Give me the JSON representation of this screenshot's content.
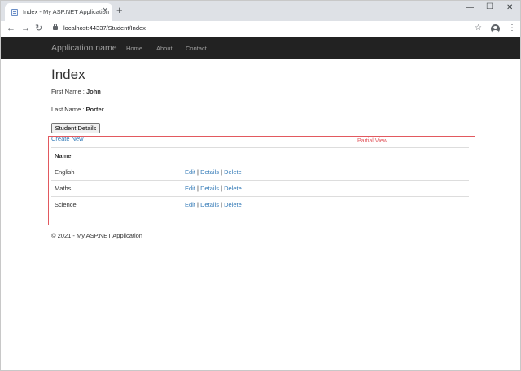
{
  "browser": {
    "tab_title": "Index - My ASP.NET Application",
    "new_tab_glyph": "+",
    "url": "localhost:44337/Student/Index"
  },
  "navbar": {
    "brand": "Application name",
    "links": [
      "Home",
      "About",
      "Contact"
    ]
  },
  "page": {
    "title": "Index",
    "first_name_label": "First Name :",
    "first_name_value": "John",
    "last_name_label": "Last Name :",
    "last_name_value": "Porter",
    "button_label": "Student Details"
  },
  "partial": {
    "annotation": "Partial View",
    "create_link": "Create New",
    "column_header": "Name",
    "rows": [
      {
        "name": "English"
      },
      {
        "name": "Maths"
      },
      {
        "name": "Science"
      }
    ],
    "action_labels": {
      "edit": "Edit",
      "details": "Details",
      "delete": "Delete",
      "separator": " | "
    }
  },
  "footer": "© 2021 - My ASP.NET Application",
  "colors": {
    "navbar": "#222222",
    "link": "#337ab7",
    "annotation": "#e2595f"
  },
  "icons": [
    "favicon-icon",
    "close-icon",
    "back-icon",
    "forward-icon",
    "reload-icon",
    "lock-icon",
    "star-icon",
    "profile-icon",
    "menu-icon",
    "minimize-icon",
    "maximize-icon"
  ]
}
